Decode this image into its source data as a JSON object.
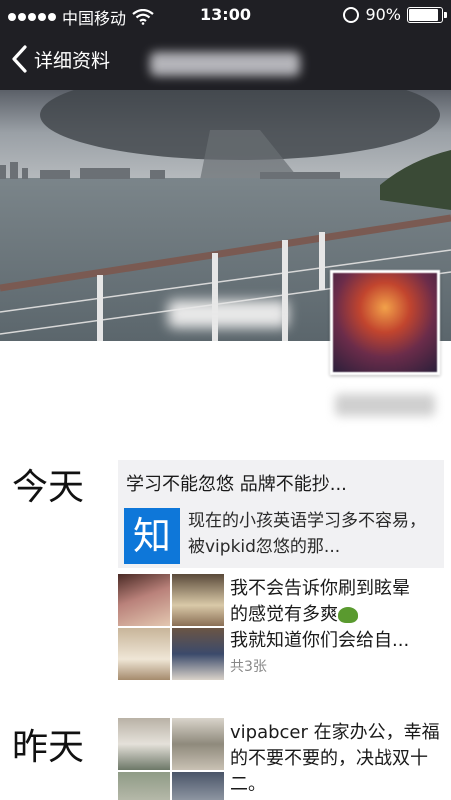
{
  "status_bar": {
    "carrier": "中国移动",
    "time": "13:00",
    "battery_text": "90%",
    "battery_level": 0.9
  },
  "nav": {
    "back_label": "详细资料"
  },
  "moments": {
    "today": {
      "label": "今天",
      "share": {
        "title": "学习不能忽悠 品牌不能抄...",
        "icon_text": "知",
        "desc": "现在的小孩英语学习多不容易，被vipkid忽悠的那..."
      },
      "post": {
        "text_line1": "我不会告诉你刷到眩晕",
        "text_line2": "的感觉有多爽",
        "text_line3": "我就知道你们会给自...",
        "count": "共3张"
      }
    },
    "yesterday": {
      "label": "昨天",
      "post": {
        "text": "vipabcer 在家办公，幸福的不要不要的，决战双十二。"
      }
    }
  },
  "colors": {
    "bar_bg": "#1f1f24",
    "zhi_blue": "#0e77d9"
  }
}
